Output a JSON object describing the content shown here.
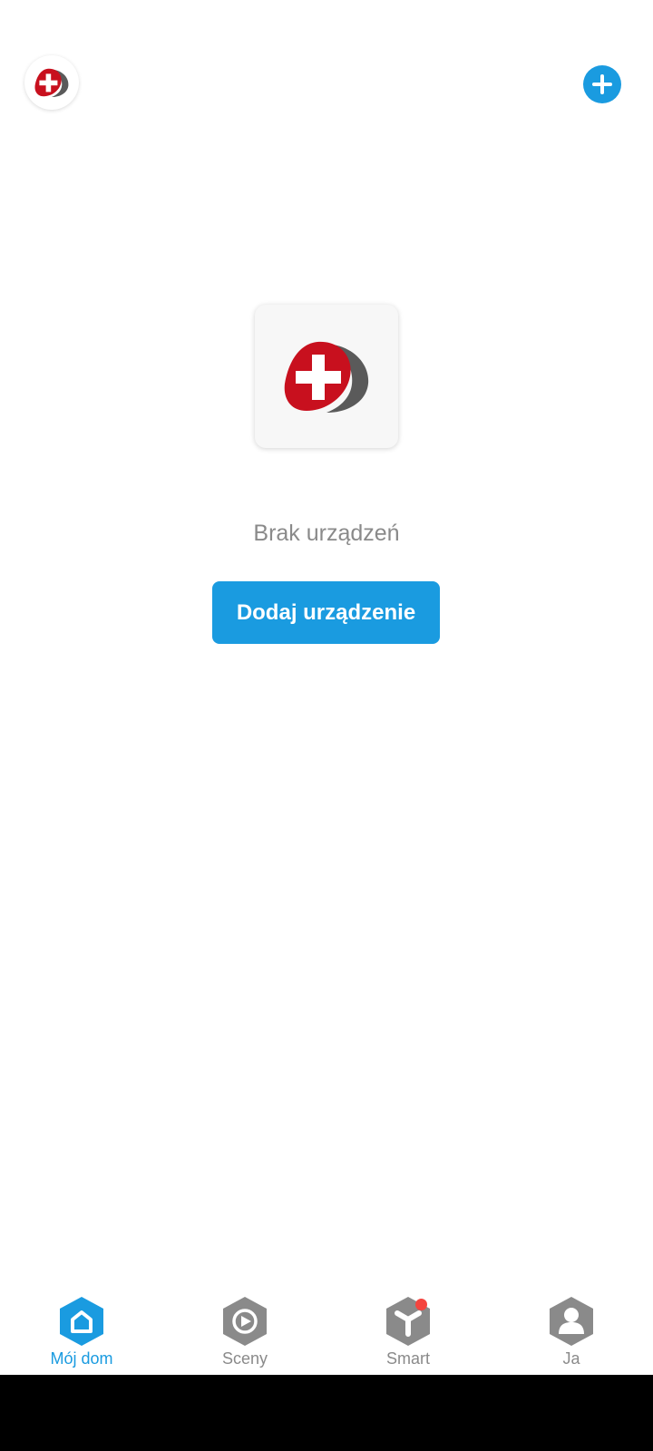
{
  "header": {
    "logo_icon": "brand-cross-logo-icon",
    "add_icon": "plus-icon"
  },
  "empty_state": {
    "logo_icon": "brand-cross-logo-icon",
    "message": "Brak urządzeń",
    "button_label": "Dodaj urządzenie"
  },
  "tabs": [
    {
      "label": "Mój dom",
      "icon": "home-icon",
      "active": true
    },
    {
      "label": "Sceny",
      "icon": "scenes-icon",
      "active": false
    },
    {
      "label": "Smart",
      "icon": "smart-icon",
      "active": false,
      "badge": true
    },
    {
      "label": "Ja",
      "icon": "profile-icon",
      "active": false
    }
  ],
  "colors": {
    "accent": "#1a9be0",
    "brand_red": "#c8101e",
    "brand_gray": "#5a5a5a",
    "tab_inactive": "#8a8a8a",
    "badge": "#f4443e"
  }
}
